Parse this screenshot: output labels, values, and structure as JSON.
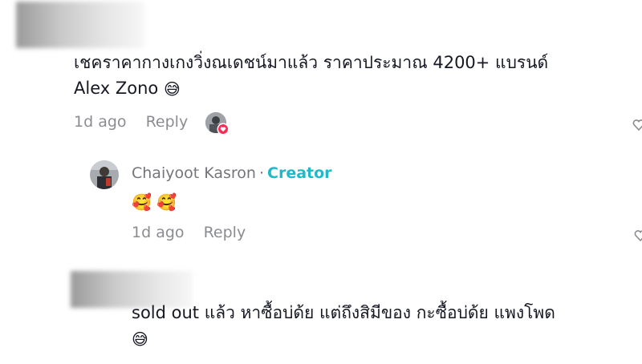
{
  "comments": [
    {
      "text_line1": "เชคราคากางเกงวิ่งณเดชน์มาแล้ว ราคาประมาณ 4200+ แบรนด์",
      "text_line2": "Alex Zono",
      "emoji": "😅",
      "time": "1d ago",
      "reply_label": "Reply"
    },
    {
      "text_line1": "sold out แล้ว หาซื้อบ่ด้ย แต่ถึงสิมีของ กะซื้อบ่ด้ย แพงโพด",
      "emoji": "😅"
    }
  ],
  "reply": {
    "author": "Chaiyoot Kasron",
    "separator": "·",
    "badge": "Creator",
    "emojis": "🥰 🥰",
    "time": "1d ago",
    "reply_label": "Reply"
  },
  "colors": {
    "text": "#161823",
    "muted": "#8a8b91",
    "creator_badge": "#20b9c9",
    "like_badge": "#fe2c55"
  },
  "icons": {
    "like": "heart-outline-icon",
    "creator_like": "creator-heart-badge-icon"
  }
}
